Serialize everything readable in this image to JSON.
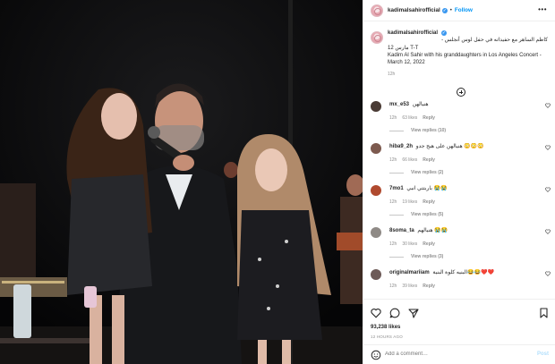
{
  "header": {
    "username": "kadimalsahirofficial",
    "follow_label": "Follow",
    "more_glyph": "•••"
  },
  "caption": {
    "username": "kadimalsahirofficial",
    "text_ar": "كاظم الساهر مع حفيداته في حفل لوس أنجلس -",
    "text_ar2": "T-T مارس 12",
    "text_en": "Kadim Al Sahir with his granddaughters in Los Angeles Concert - March 12, 2022",
    "time": "12h"
  },
  "comments": [
    {
      "user": "mx_e53",
      "text": "هنيالهن",
      "time": "12h",
      "likes": "63 likes",
      "reply": "Reply",
      "view": "View replies (10)",
      "avatar_color": "#4a3b35"
    },
    {
      "user": "hiba9_2h",
      "text": "هنيالهن على هيج جدو 😳😳😳",
      "time": "12h",
      "likes": "66 likes",
      "reply": "Reply",
      "view": "View replies (2)",
      "avatar_color": "#7d5a4f"
    },
    {
      "user": "7mo1",
      "text": "باربتتي انبي 😭😭",
      "time": "12h",
      "likes": "19 likes",
      "reply": "Reply",
      "view": "View replies (5)",
      "avatar_color": "#b04a2f"
    },
    {
      "user": "8soma_ta",
      "text": "هنيالهم 😭😭",
      "time": "12h",
      "likes": "30 likes",
      "reply": "Reply",
      "view": "View replies (3)",
      "avatar_color": "#8f8a86"
    },
    {
      "user": "originalmariiam",
      "text": "البنيه كلوة البنية😂😂❤️❤️",
      "time": "12h",
      "likes": "39 likes",
      "reply": "Reply",
      "view": "",
      "avatar_color": "#6d5a57"
    }
  ],
  "footer": {
    "likes": "93,238 likes",
    "time_ago": "12 HOURS AGO",
    "add_comment_placeholder": "Add a comment…",
    "post_label": "Post"
  },
  "colors": {
    "link_blue": "#0095f6",
    "muted": "#8e8e8e",
    "post_disabled": "#b2dffc"
  }
}
